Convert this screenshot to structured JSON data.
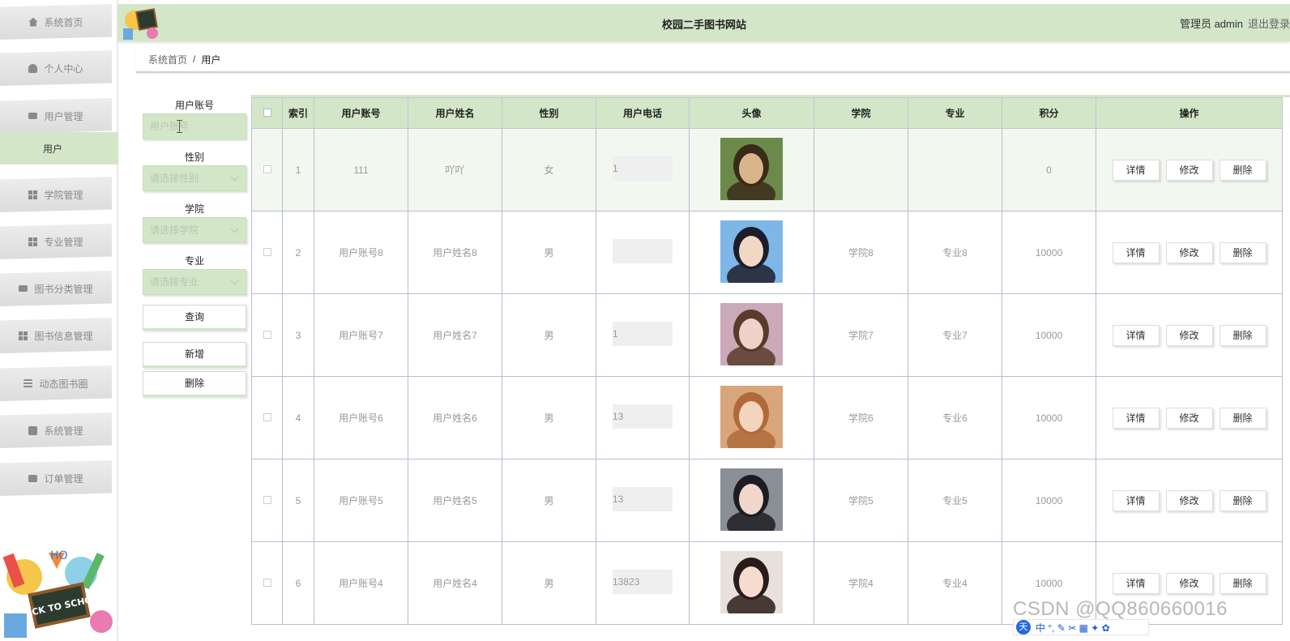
{
  "header": {
    "title": "校园二手图书网站",
    "user": "管理员 admin",
    "logout": "退出登录"
  },
  "sidebar": {
    "items": [
      {
        "label": "系统首页",
        "icon": "home-icon"
      },
      {
        "label": "个人中心",
        "icon": "user-icon"
      },
      {
        "label": "用户管理",
        "icon": "monitor-icon"
      },
      {
        "label": "学院管理",
        "icon": "grid-icon"
      },
      {
        "label": "专业管理",
        "icon": "grid-icon"
      },
      {
        "label": "图书分类管理",
        "icon": "ticket-icon"
      },
      {
        "label": "图书信息管理",
        "icon": "grid-icon"
      },
      {
        "label": "动态图书圈",
        "icon": "menu-icon"
      },
      {
        "label": "系统管理",
        "icon": "chart-icon"
      },
      {
        "label": "订单管理",
        "icon": "briefcase-icon"
      }
    ],
    "sub_item": "用户",
    "logo_text": "BACK TO SCHOOL",
    "logo_letters": "HO"
  },
  "breadcrumb": {
    "home": "系统首页",
    "separator": "/",
    "current": "用户"
  },
  "search": {
    "account_label": "用户账号",
    "account_placeholder": "用户账号",
    "gender_label": "性别",
    "gender_placeholder": "请选择性别",
    "college_label": "学院",
    "college_placeholder": "请选择学院",
    "major_label": "专业",
    "major_placeholder": "请选择专业",
    "query_btn": "查询",
    "add_btn": "新增",
    "delete_btn": "删除"
  },
  "table": {
    "headers": [
      "索引",
      "用户账号",
      "用户姓名",
      "性别",
      "用户电话",
      "头像",
      "学院",
      "专业",
      "积分",
      "操作"
    ],
    "rows": [
      {
        "index": "1",
        "account": "111",
        "name": "吖吖",
        "gender": "女",
        "phone": "1",
        "college": "",
        "major": "",
        "points": "0"
      },
      {
        "index": "2",
        "account": "用户账号8",
        "name": "用户姓名8",
        "gender": "男",
        "phone": "",
        "college": "学院8",
        "major": "专业8",
        "points": "10000"
      },
      {
        "index": "3",
        "account": "用户账号7",
        "name": "用户姓名7",
        "gender": "男",
        "phone": "1",
        "college": "学院7",
        "major": "专业7",
        "points": "10000"
      },
      {
        "index": "4",
        "account": "用户账号6",
        "name": "用户姓名6",
        "gender": "男",
        "phone": "13",
        "college": "学院6",
        "major": "专业6",
        "points": "10000"
      },
      {
        "index": "5",
        "account": "用户账号5",
        "name": "用户姓名5",
        "gender": "男",
        "phone": "13",
        "college": "学院5",
        "major": "专业5",
        "points": "10000"
      },
      {
        "index": "6",
        "account": "用户账号4",
        "name": "用户姓名4",
        "gender": "男",
        "phone": "13823",
        "college": "学院4",
        "major": "专业4",
        "points": "10000"
      }
    ],
    "actions": {
      "detail": "详情",
      "edit": "修改",
      "delete": "删除"
    }
  },
  "overlay": {
    "watermark": "CSDN @QQ860660016",
    "ime_logo": "天",
    "ime_text": "中 °, ✎ ✂ ▦ ✦ ✿"
  }
}
